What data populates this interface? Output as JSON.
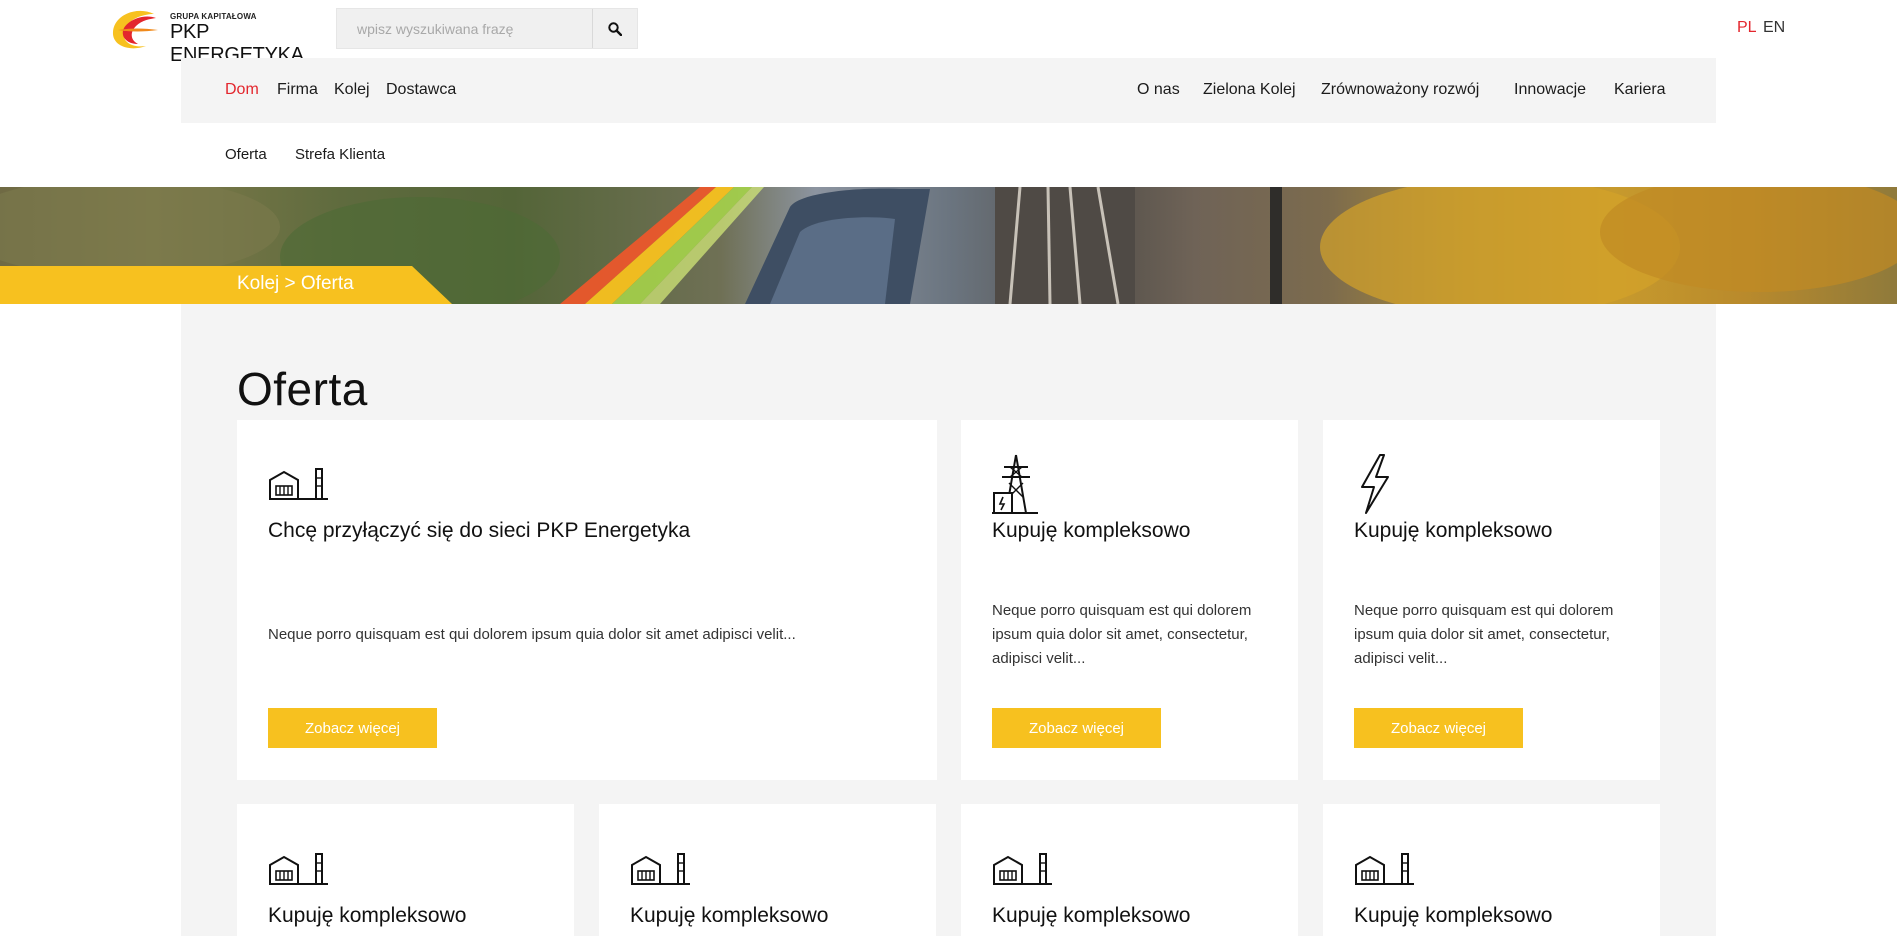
{
  "brand": {
    "group_label": "GRUPA KAPITAŁOWA",
    "name": "PKP ENERGETYKA",
    "colors": {
      "accent_red": "#e3262d",
      "accent_yellow": "#f7c11f",
      "panel_gray": "#f4f4f4"
    }
  },
  "search": {
    "placeholder": "wpisz wyszukiwana frazę",
    "value": "",
    "icon": "search-icon"
  },
  "languages": [
    {
      "label": "PL",
      "active": true
    },
    {
      "label": "EN",
      "active": false
    }
  ],
  "nav": {
    "left": [
      "Dom",
      "Firma",
      "Kolej",
      "Dostawca"
    ],
    "right": [
      "O nas",
      "Zielona Kolej",
      "Zrównoważony rozwój",
      "Innowacje",
      "Kariera"
    ],
    "active": "Dom"
  },
  "subnav": [
    "Oferta",
    "Strefa Klienta"
  ],
  "breadcrumb": "Kolej  >  Oferta",
  "page_title": "Oferta",
  "cards": [
    {
      "icon": "substation-icon",
      "title": "Chcę przyłączyć się do sieci PKP Energetyka",
      "text": "Neque porro quisquam est qui dolorem ipsum quia dolor sit amet adipisci velit...",
      "button": "Zobacz więcej"
    },
    {
      "icon": "power-tower-icon",
      "title": "Kupuję kompleksowo",
      "text": "Neque porro quisquam est qui dolorem ipsum quia dolor sit amet, consectetur, adipisci velit...",
      "button": "Zobacz więcej"
    },
    {
      "icon": "lightning-icon",
      "title": "Kupuję kompleksowo",
      "text": "Neque porro quisquam est qui dolorem ipsum quia dolor sit amet, consectetur, adipisci velit...",
      "button": "Zobacz więcej"
    },
    {
      "icon": "substation-icon",
      "title": "Kupuję kompleksowo"
    },
    {
      "icon": "substation-icon",
      "title": "Kupuję kompleksowo"
    },
    {
      "icon": "substation-icon",
      "title": "Kupuję kompleksowo"
    },
    {
      "icon": "substation-icon",
      "title": "Kupuję kompleksowo"
    }
  ]
}
